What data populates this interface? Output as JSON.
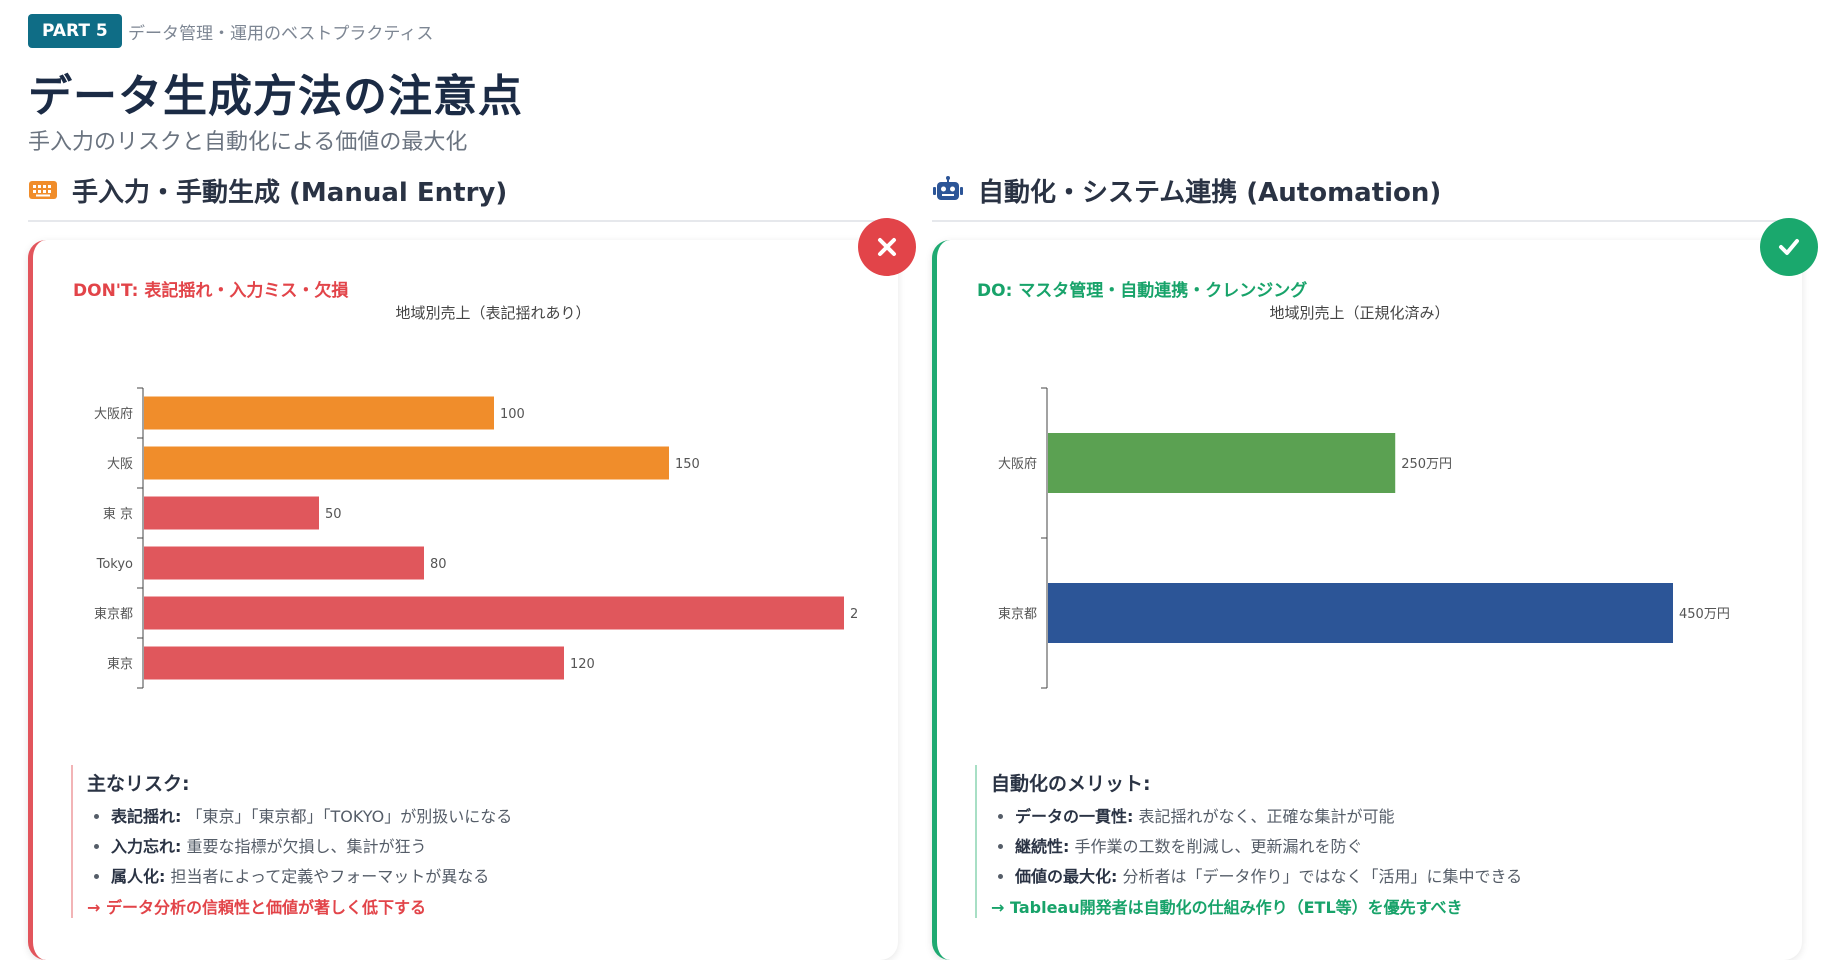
{
  "header": {
    "badge": "PART 5",
    "section": "データ管理・運用のベストプラクティス",
    "title": "データ生成方法の注意点",
    "subtitle": "手入力のリスクと自動化による価値の最大化"
  },
  "left": {
    "heading": "手入力・手動生成 (Manual Entry)",
    "icon": "keyboard-icon",
    "tag": "DON'T: 表記揺れ・入力ミス・欠損",
    "notes_title": "主なリスク:",
    "notes": [
      {
        "key": "表記揺れ:",
        "text": " 「東京」「東京都」「TOKYO」が別扱いになる"
      },
      {
        "key": "入力忘れ:",
        "text": " 重要な指標が欠損し、集計が狂う"
      },
      {
        "key": "属人化:",
        "text": " 担当者によって定義やフォーマットが異なる"
      }
    ],
    "conclusion": "→ データ分析の信頼性と価値が著しく低下する"
  },
  "right": {
    "heading": "自動化・システム連携 (Automation)",
    "icon": "robot-icon",
    "tag": "DO: マスタ管理・自動連携・クレンジング",
    "notes_title": "自動化のメリット:",
    "notes": [
      {
        "key": "データの一貫性:",
        "text": " 表記揺れがなく、正確な集計が可能"
      },
      {
        "key": "継続性:",
        "text": " 手作業の工数を削減し、更新漏れを防ぐ"
      },
      {
        "key": "価値の最大化:",
        "text": " 分析者は「データ作り」ではなく「活用」に集中できる"
      }
    ],
    "conclusion": "→ Tableau開発者は自動化の仕組み作り（ETL等）を優先すべき"
  },
  "chart_data": [
    {
      "type": "bar",
      "orientation": "horizontal",
      "title": "地域別売上（表記揺れあり）",
      "categories": [
        "大阪府",
        "大阪",
        "東 京",
        "Tokyo",
        "東京都",
        "東京"
      ],
      "values": [
        100,
        150,
        50,
        80,
        200,
        120
      ],
      "value_labels": [
        "100",
        "150",
        "50",
        "80",
        "2",
        "120"
      ],
      "colors": [
        "#f08d2b",
        "#f08d2b",
        "#e0575c",
        "#e0575c",
        "#e0575c",
        "#e0575c"
      ],
      "xlim": [
        0,
        200
      ],
      "grid": false
    },
    {
      "type": "bar",
      "orientation": "horizontal",
      "title": "地域別売上（正規化済み）",
      "categories": [
        "大阪府",
        "東京都"
      ],
      "values": [
        250,
        450
      ],
      "value_labels": [
        "250万円",
        "450万円"
      ],
      "colors": [
        "#5ba152",
        "#2c5597"
      ],
      "xlim": [
        0,
        450
      ],
      "grid": false
    }
  ],
  "colors": {
    "badge_bg": "#0f6d86",
    "bad": "#e24449",
    "good": "#18a36a",
    "title": "#1b2b45"
  }
}
